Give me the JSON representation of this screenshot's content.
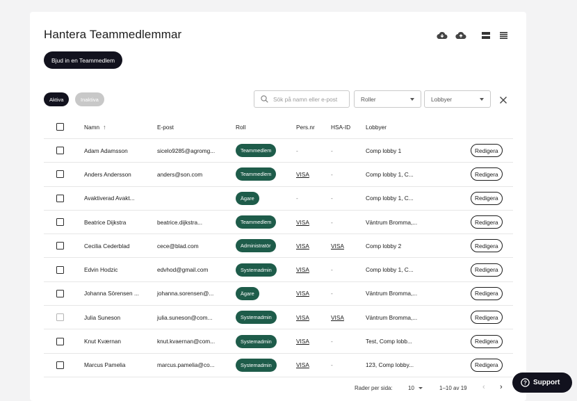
{
  "page": {
    "title": "Hantera Teammedlemmar",
    "invite_label": "Bjud in en Teammedlem"
  },
  "filters": {
    "chip_active": "Aktiva",
    "chip_inactive": "Inaktiva",
    "search_placeholder": "Sök på namn eller e-post",
    "roles_label": "Roller",
    "lobbies_label": "Lobbyer"
  },
  "toolbar_icons": [
    "cloud-download-icon",
    "cloud-upload-icon",
    "view-compact-icon",
    "view-list-icon"
  ],
  "table": {
    "columns": [
      "Namn",
      "E-post",
      "Roll",
      "Pers.nr",
      "HSA-ID",
      "Lobbyer"
    ],
    "rows": [
      {
        "name": "Adam Adamsson",
        "email": "sicelo9285@agromg...",
        "role": "Teammedlem",
        "pnr": "-",
        "hsa": "-",
        "lobby": "Comp lobby 1",
        "edit": "Redigera"
      },
      {
        "name": "Anders Andersson",
        "email": "anders@son.com",
        "role": "Teammedlem",
        "pnr": "VISA",
        "hsa": "-",
        "lobby": "Comp lobby 1, C...",
        "edit": "Redigera"
      },
      {
        "name": "Avaktiverad Avakt...",
        "email": "",
        "role": "Ägare",
        "pnr": "-",
        "hsa": "-",
        "lobby": "Comp lobby 1, C...",
        "edit": "Redigera"
      },
      {
        "name": "Beatrice Dijkstra",
        "email": "beatrice.dijkstra...",
        "role": "Teammedlem",
        "pnr": "VISA",
        "hsa": "-",
        "lobby": "Väntrum Bromma,...",
        "edit": "Redigera"
      },
      {
        "name": "Cecilia Cederblad",
        "email": "cece@blad.com",
        "role": "Administratör",
        "pnr": "VISA",
        "hsa": "VISA",
        "lobby": "Comp lobby 2",
        "edit": "Redigera"
      },
      {
        "name": "Edvin Hodzic",
        "email": "edvhod@gmail.com",
        "role": "Systemadmin",
        "pnr": "VISA",
        "hsa": "-",
        "lobby": "Comp lobby 1, C...",
        "edit": "Redigera"
      },
      {
        "name": "Johanna Sörensen ...",
        "email": "johanna.sorensen@...",
        "role": "Ägare",
        "pnr": "VISA",
        "hsa": "-",
        "lobby": "Väntrum Bromma,...",
        "edit": "Redigera"
      },
      {
        "name": "Julia Suneson",
        "email": "julia.suneson@com...",
        "role": "Systemadmin",
        "pnr": "VISA",
        "hsa": "VISA",
        "lobby": "Väntrum Bromma,...",
        "edit": "Redigera"
      },
      {
        "name": "Knut Kværnan",
        "email": "knut.kvaernan@com...",
        "role": "Systemadmin",
        "pnr": "VISA",
        "hsa": "-",
        "lobby": "Test, Comp lobb...",
        "edit": "Redigera"
      },
      {
        "name": "Marcus Pamelia",
        "email": "marcus.pamelia@co...",
        "role": "Systemadmin",
        "pnr": "VISA",
        "hsa": "-",
        "lobby": "123, Comp lobby...",
        "edit": "Redigera"
      }
    ]
  },
  "pagination": {
    "rows_per_page_label": "Rader per sida:",
    "rows_per_page": "10",
    "range": "1–10 av 19"
  },
  "support_label": "Support",
  "colors": {
    "dark": "#12121e",
    "role_badge": "#1e5c4a",
    "background": "#f3f3f4"
  }
}
